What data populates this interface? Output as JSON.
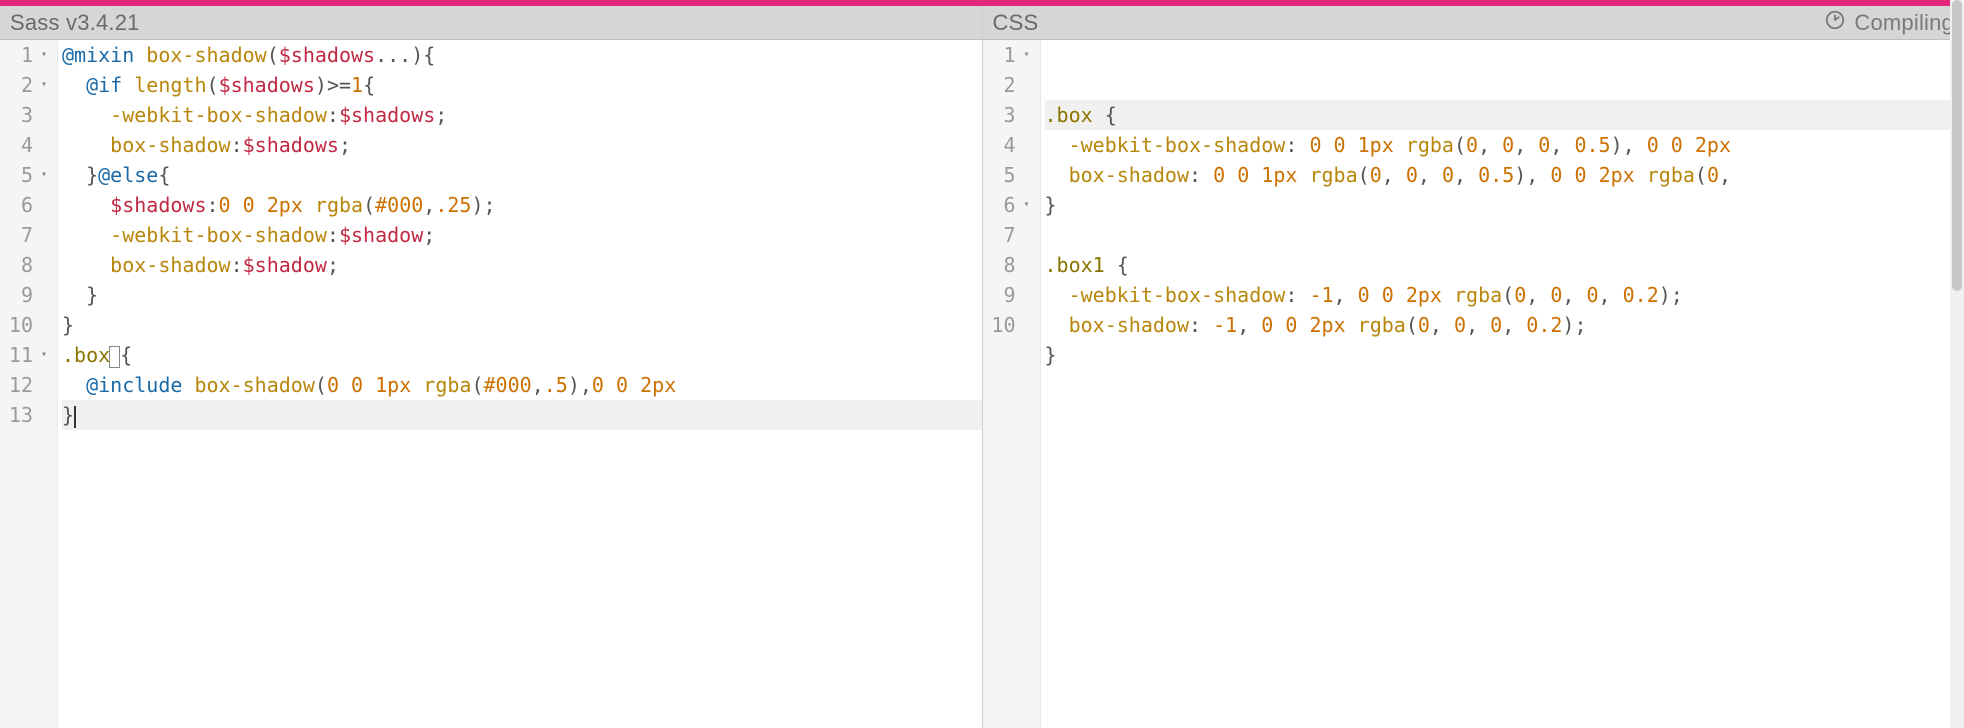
{
  "topbar_color": "#e6257c",
  "left": {
    "title": "Sass v3.4.21",
    "active_line": 13,
    "lines": [
      {
        "n": 1,
        "fold": true,
        "tokens": [
          [
            "kw",
            "@mixin"
          ],
          [
            "sp",
            " "
          ],
          [
            "fn",
            "box-shadow"
          ],
          [
            "punc",
            "("
          ],
          [
            "var",
            "$shadows"
          ],
          [
            "punc",
            "..."
          ],
          [
            "punc",
            ")"
          ],
          [
            "punc",
            "{"
          ]
        ]
      },
      {
        "n": 2,
        "fold": true,
        "indent": 1,
        "tokens": [
          [
            "kw",
            "@if"
          ],
          [
            "sp",
            " "
          ],
          [
            "fn",
            "length"
          ],
          [
            "punc",
            "("
          ],
          [
            "var",
            "$shadows"
          ],
          [
            "punc",
            ")"
          ],
          [
            "op",
            ">="
          ],
          [
            "num",
            "1"
          ],
          [
            "punc",
            "{"
          ]
        ]
      },
      {
        "n": 3,
        "indent": 2,
        "tokens": [
          [
            "fn",
            "-webkit-box-shadow"
          ],
          [
            "punc",
            ":"
          ],
          [
            "var",
            "$shadows"
          ],
          [
            "punc",
            ";"
          ]
        ]
      },
      {
        "n": 4,
        "indent": 2,
        "tokens": [
          [
            "fn",
            "box-shadow"
          ],
          [
            "punc",
            ":"
          ],
          [
            "var",
            "$shadows"
          ],
          [
            "punc",
            ";"
          ]
        ]
      },
      {
        "n": 5,
        "fold": true,
        "indent": 1,
        "tokens": [
          [
            "punc",
            "}"
          ],
          [
            "kw",
            "@else"
          ],
          [
            "punc",
            "{"
          ]
        ]
      },
      {
        "n": 6,
        "indent": 2,
        "tokens": [
          [
            "var",
            "$shadows"
          ],
          [
            "punc",
            ":"
          ],
          [
            "num",
            "0"
          ],
          [
            "sp",
            " "
          ],
          [
            "num",
            "0"
          ],
          [
            "sp",
            " "
          ],
          [
            "num",
            "2px"
          ],
          [
            "sp",
            " "
          ],
          [
            "fn",
            "rgba"
          ],
          [
            "punc",
            "("
          ],
          [
            "num",
            "#000"
          ],
          [
            "punc",
            ","
          ],
          [
            "num",
            ".25"
          ],
          [
            "punc",
            ")"
          ],
          [
            "punc",
            ";"
          ]
        ]
      },
      {
        "n": 7,
        "indent": 2,
        "tokens": [
          [
            "fn",
            "-webkit-box-shadow"
          ],
          [
            "punc",
            ":"
          ],
          [
            "var",
            "$shadow"
          ],
          [
            "punc",
            ";"
          ]
        ]
      },
      {
        "n": 8,
        "indent": 2,
        "tokens": [
          [
            "fn",
            "box-shadow"
          ],
          [
            "punc",
            ":"
          ],
          [
            "var",
            "$shadow"
          ],
          [
            "punc",
            ";"
          ]
        ]
      },
      {
        "n": 9,
        "indent": 1,
        "tokens": [
          [
            "punc",
            "}"
          ]
        ]
      },
      {
        "n": 10,
        "tokens": [
          [
            "punc",
            "}"
          ]
        ]
      },
      {
        "n": 11,
        "fold": true,
        "tokens": [
          [
            "sel",
            ".box"
          ],
          [
            "cursorbox",
            ""
          ],
          [
            "punc",
            "{"
          ]
        ]
      },
      {
        "n": 12,
        "indent": 1,
        "tokens": [
          [
            "kw",
            "@include"
          ],
          [
            "sp",
            " "
          ],
          [
            "fn",
            "box-shadow"
          ],
          [
            "punc",
            "("
          ],
          [
            "num",
            "0"
          ],
          [
            "sp",
            " "
          ],
          [
            "num",
            "0"
          ],
          [
            "sp",
            " "
          ],
          [
            "num",
            "1px"
          ],
          [
            "sp",
            " "
          ],
          [
            "fn",
            "rgba"
          ],
          [
            "punc",
            "("
          ],
          [
            "num",
            "#000"
          ],
          [
            "punc",
            ","
          ],
          [
            "num",
            ".5"
          ],
          [
            "punc",
            ")"
          ],
          [
            "punc",
            ","
          ],
          [
            "num",
            "0"
          ],
          [
            "sp",
            " "
          ],
          [
            "num",
            "0"
          ],
          [
            "sp",
            " "
          ],
          [
            "num",
            "2px"
          ]
        ]
      },
      {
        "n": 13,
        "tokens": [
          [
            "punc",
            "}"
          ],
          [
            "cursor",
            ""
          ]
        ]
      }
    ]
  },
  "right": {
    "title": "CSS",
    "status": "Compiling",
    "active_line": 1,
    "lines": [
      {
        "n": 1,
        "fold": true,
        "tokens": [
          [
            "sel",
            ".box"
          ],
          [
            "sp",
            " "
          ],
          [
            "punc",
            "{"
          ]
        ]
      },
      {
        "n": 2,
        "indent": 1,
        "tokens": [
          [
            "fn",
            "-webkit-box-shadow"
          ],
          [
            "punc",
            ":"
          ],
          [
            "sp",
            " "
          ],
          [
            "num",
            "0"
          ],
          [
            "sp",
            " "
          ],
          [
            "num",
            "0"
          ],
          [
            "sp",
            " "
          ],
          [
            "num",
            "1px"
          ],
          [
            "sp",
            " "
          ],
          [
            "fn",
            "rgba"
          ],
          [
            "punc",
            "("
          ],
          [
            "num",
            "0"
          ],
          [
            "punc",
            ", "
          ],
          [
            "num",
            "0"
          ],
          [
            "punc",
            ", "
          ],
          [
            "num",
            "0"
          ],
          [
            "punc",
            ", "
          ],
          [
            "num",
            "0.5"
          ],
          [
            "punc",
            ")"
          ],
          [
            "punc",
            ", "
          ],
          [
            "num",
            "0"
          ],
          [
            "sp",
            " "
          ],
          [
            "num",
            "0"
          ],
          [
            "sp",
            " "
          ],
          [
            "num",
            "2px"
          ]
        ]
      },
      {
        "n": 3,
        "indent": 1,
        "tokens": [
          [
            "fn",
            "box-shadow"
          ],
          [
            "punc",
            ":"
          ],
          [
            "sp",
            " "
          ],
          [
            "num",
            "0"
          ],
          [
            "sp",
            " "
          ],
          [
            "num",
            "0"
          ],
          [
            "sp",
            " "
          ],
          [
            "num",
            "1px"
          ],
          [
            "sp",
            " "
          ],
          [
            "fn",
            "rgba"
          ],
          [
            "punc",
            "("
          ],
          [
            "num",
            "0"
          ],
          [
            "punc",
            ", "
          ],
          [
            "num",
            "0"
          ],
          [
            "punc",
            ", "
          ],
          [
            "num",
            "0"
          ],
          [
            "punc",
            ", "
          ],
          [
            "num",
            "0.5"
          ],
          [
            "punc",
            ")"
          ],
          [
            "punc",
            ", "
          ],
          [
            "num",
            "0"
          ],
          [
            "sp",
            " "
          ],
          [
            "num",
            "0"
          ],
          [
            "sp",
            " "
          ],
          [
            "num",
            "2px"
          ],
          [
            "sp",
            " "
          ],
          [
            "fn",
            "rgba"
          ],
          [
            "punc",
            "("
          ],
          [
            "num",
            "0"
          ],
          [
            "punc",
            ","
          ]
        ]
      },
      {
        "n": 4,
        "tokens": [
          [
            "punc",
            "}"
          ]
        ]
      },
      {
        "n": 5,
        "tokens": []
      },
      {
        "n": 6,
        "fold": true,
        "tokens": [
          [
            "sel",
            ".box1"
          ],
          [
            "sp",
            " "
          ],
          [
            "punc",
            "{"
          ]
        ]
      },
      {
        "n": 7,
        "indent": 1,
        "tokens": [
          [
            "fn",
            "-webkit-box-shadow"
          ],
          [
            "punc",
            ":"
          ],
          [
            "sp",
            " "
          ],
          [
            "num",
            "-1"
          ],
          [
            "punc",
            ", "
          ],
          [
            "num",
            "0"
          ],
          [
            "sp",
            " "
          ],
          [
            "num",
            "0"
          ],
          [
            "sp",
            " "
          ],
          [
            "num",
            "2px"
          ],
          [
            "sp",
            " "
          ],
          [
            "fn",
            "rgba"
          ],
          [
            "punc",
            "("
          ],
          [
            "num",
            "0"
          ],
          [
            "punc",
            ", "
          ],
          [
            "num",
            "0"
          ],
          [
            "punc",
            ", "
          ],
          [
            "num",
            "0"
          ],
          [
            "punc",
            ", "
          ],
          [
            "num",
            "0.2"
          ],
          [
            "punc",
            ")"
          ],
          [
            "punc",
            ";"
          ]
        ]
      },
      {
        "n": 8,
        "indent": 1,
        "tokens": [
          [
            "fn",
            "box-shadow"
          ],
          [
            "punc",
            ":"
          ],
          [
            "sp",
            " "
          ],
          [
            "num",
            "-1"
          ],
          [
            "punc",
            ", "
          ],
          [
            "num",
            "0"
          ],
          [
            "sp",
            " "
          ],
          [
            "num",
            "0"
          ],
          [
            "sp",
            " "
          ],
          [
            "num",
            "2px"
          ],
          [
            "sp",
            " "
          ],
          [
            "fn",
            "rgba"
          ],
          [
            "punc",
            "("
          ],
          [
            "num",
            "0"
          ],
          [
            "punc",
            ", "
          ],
          [
            "num",
            "0"
          ],
          [
            "punc",
            ", "
          ],
          [
            "num",
            "0"
          ],
          [
            "punc",
            ", "
          ],
          [
            "num",
            "0.2"
          ],
          [
            "punc",
            ")"
          ],
          [
            "punc",
            ";"
          ]
        ]
      },
      {
        "n": 9,
        "tokens": [
          [
            "punc",
            "}"
          ]
        ]
      },
      {
        "n": 10,
        "tokens": []
      }
    ]
  }
}
